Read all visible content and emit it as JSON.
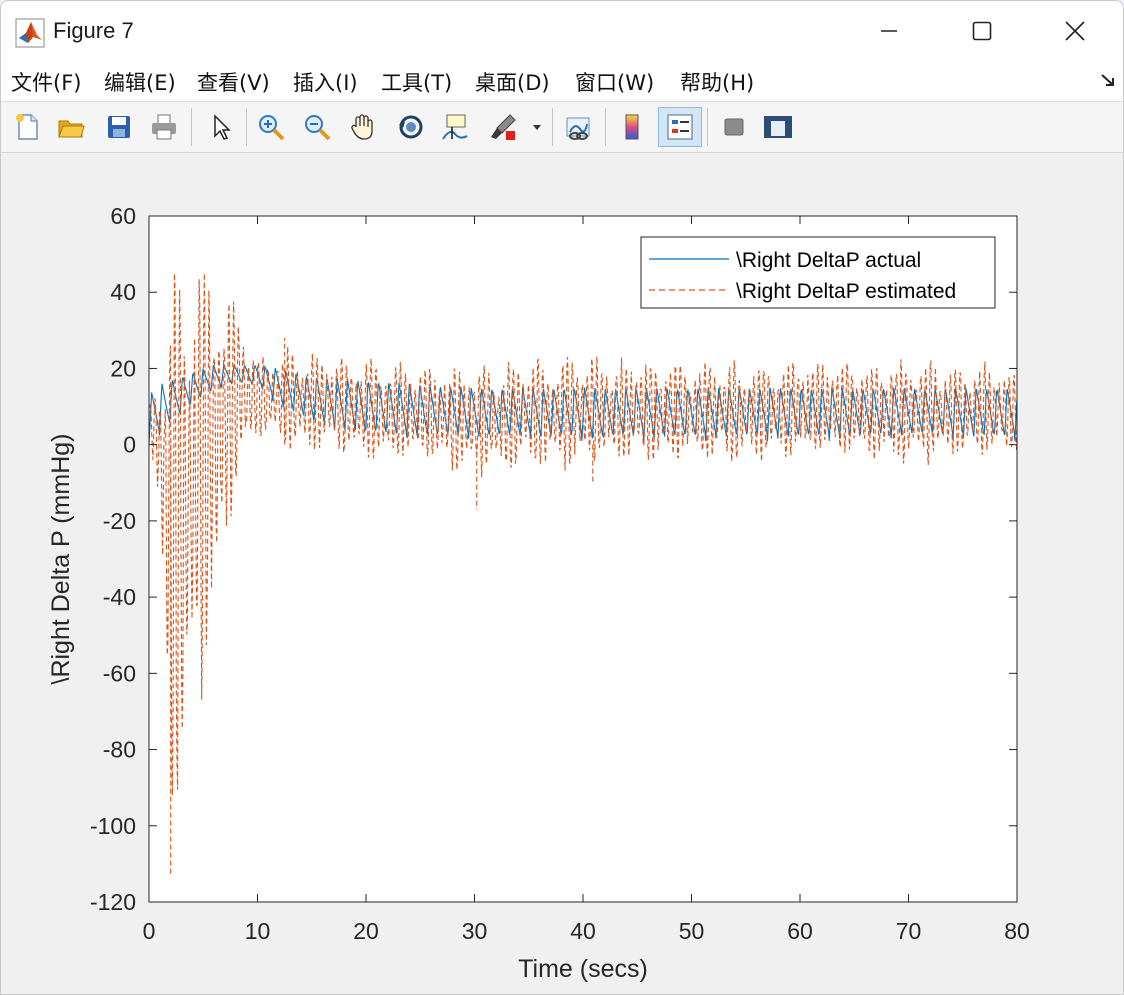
{
  "window": {
    "title": "Figure 7"
  },
  "menu": [
    {
      "label": "文件(F)"
    },
    {
      "label": "编辑(E)"
    },
    {
      "label": "查看(V)"
    },
    {
      "label": "插入(I)"
    },
    {
      "label": "工具(T)"
    },
    {
      "label": "桌面(D)"
    },
    {
      "label": "窗口(W)"
    },
    {
      "label": "帮助(H)"
    }
  ],
  "toolbar": [
    {
      "icon": "new-figure-icon"
    },
    {
      "icon": "open-file-icon"
    },
    {
      "icon": "save-icon"
    },
    {
      "icon": "print-icon"
    },
    {
      "icon": "edit-plot-arrow-icon"
    },
    {
      "icon": "zoom-in-icon"
    },
    {
      "icon": "zoom-out-icon"
    },
    {
      "icon": "pan-hand-icon"
    },
    {
      "icon": "rotate-3d-icon"
    },
    {
      "icon": "data-cursor-icon"
    },
    {
      "icon": "brush-icon"
    },
    {
      "icon": "link-plot-icon"
    },
    {
      "icon": "colorbar-icon"
    },
    {
      "icon": "legend-icon"
    },
    {
      "icon": "hide-plot-tools-icon"
    },
    {
      "icon": "show-plot-tools-icon"
    }
  ],
  "colors": {
    "actual": "#0072bd",
    "estimated": "#d95319"
  },
  "chart_data": {
    "type": "line",
    "xlabel": "Time (secs)",
    "ylabel": "\\Right Delta P (mmHg)",
    "xlim": [
      0,
      80
    ],
    "ylim": [
      -120,
      60
    ],
    "xticks": [
      0,
      10,
      20,
      30,
      40,
      50,
      60,
      70,
      80
    ],
    "yticks": [
      -120,
      -100,
      -80,
      -60,
      -40,
      -20,
      0,
      20,
      40,
      60
    ],
    "grid": false,
    "legend_position": "top-right",
    "legend": [
      "\\Right DeltaP actual",
      "\\Right DeltaP estimated"
    ],
    "series": [
      {
        "name": "\\Right DeltaP actual",
        "style": "solid",
        "x": [
          0,
          1,
          2,
          4,
          6,
          8,
          10,
          12,
          15,
          20,
          25,
          30,
          35,
          40,
          45,
          50,
          55,
          60,
          65,
          70,
          75,
          80
        ],
        "upper": [
          13,
          16,
          17,
          19,
          21,
          21,
          21,
          20,
          18,
          17,
          16,
          15,
          15,
          15,
          15,
          15,
          15,
          15,
          15,
          15,
          15,
          15
        ],
        "lower": [
          0,
          2,
          5,
          10,
          14,
          16,
          15,
          10,
          5,
          2,
          1,
          1,
          1,
          1,
          1,
          1,
          1,
          1,
          1,
          2,
          1,
          1
        ],
        "period": 0.95
      },
      {
        "name": "\\Right DeltaP estimated",
        "style": "dashed",
        "x": [
          0,
          1,
          2,
          4,
          6,
          8,
          10,
          12,
          15,
          20,
          25,
          30,
          35,
          40,
          45,
          50,
          55,
          60,
          65,
          70,
          75,
          80
        ],
        "upper": [
          10,
          20,
          50,
          50,
          45,
          40,
          22,
          24,
          25,
          22,
          21,
          20,
          22,
          23,
          22,
          21,
          21,
          22,
          22,
          22,
          21,
          20
        ],
        "lower": [
          5,
          -20,
          -105,
          -75,
          -45,
          -10,
          2,
          0,
          -2,
          -3,
          -4,
          -8,
          -6,
          -5,
          -4,
          -3,
          -4,
          -3,
          -3,
          -4,
          -3,
          -2
        ],
        "period": 0.95
      }
    ]
  }
}
